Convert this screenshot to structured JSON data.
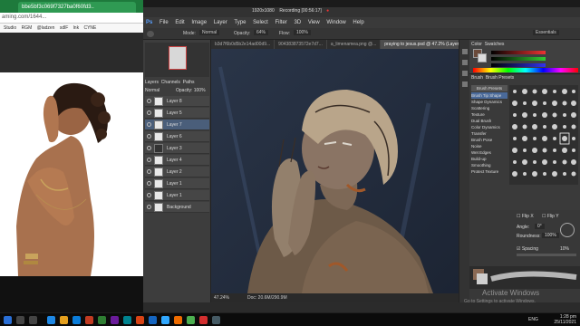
{
  "browser": {
    "tab_title": "bbe5bf3c069f7327ba0f60fd3..",
    "url": "aming.com/1644...",
    "bookmarks": [
      "Studio",
      "RGM",
      "@ladzen",
      "sdlF",
      "lnk",
      "CYNE"
    ]
  },
  "photoshop": {
    "recording": "Recording [00:56:17]",
    "resolution": "1920x1080",
    "menu": [
      "File",
      "Edit",
      "Image",
      "Layer",
      "Type",
      "Select",
      "Filter",
      "3D",
      "View",
      "Window",
      "Help"
    ],
    "options": {
      "mode_label": "Mode:",
      "mode": "Normal",
      "opacity_label": "Opacity:",
      "opacity": "64%",
      "flow_label": "Flow:",
      "flow": "100%"
    },
    "doc_tabs": [
      "b3d7f6b0d5b2e14ad00d9...",
      "904383873572e7d7...",
      "a_limenamea.png @...",
      "praying to jesus.psd @ 47.2% (Layer 7, RGB/8#)"
    ],
    "zoom": "47.24%",
    "doc_size": "Doc: 20.6M/290.9M",
    "layers_header": [
      "Layers",
      "Channels",
      "Paths"
    ],
    "layer_mode": "Normal",
    "layer_opacity": "Opacity: 100%",
    "layers": [
      "Layer 8",
      "Layer 5",
      "Layer 7",
      "Layer 6",
      "Layer 3",
      "Layer 4",
      "Layer 2",
      "Layer 1",
      "Layer 1",
      "Background"
    ],
    "active_layer_index": 2,
    "panels": {
      "color_tab": "Color",
      "swatches_tab": "Swatches",
      "brush_tab": "Brush",
      "brush_presets_tab": "Brush Presets",
      "brush_presets_button": "Brush Presets"
    },
    "brush_options": [
      "Brush Tip Shape",
      "Shape Dynamics",
      "Scattering",
      "Texture",
      "Dual Brush",
      "Color Dynamics",
      "Transfer",
      "Brush Pose",
      "Noise",
      "Wet Edges",
      "Build-up",
      "Smoothing",
      "Protect Texture"
    ],
    "brush_settings": {
      "flip_x": "Flip X",
      "flip_y": "Flip Y",
      "angle_label": "Angle:",
      "angle": "0°",
      "roundness_label": "Roundness:",
      "roundness": "100%",
      "spacing_label": "Spacing",
      "spacing": "10%"
    },
    "essentials": "Essentials"
  },
  "watermark": {
    "title": "Activate Windows",
    "subtitle": "Go to Settings to activate Windows."
  },
  "taskbar": {
    "lang": "ENG",
    "time": "1:28 pm",
    "date": "25/11/2021"
  },
  "colors": {
    "browser_green": "#1e7a3c",
    "ps_bg": "#2b2b2b",
    "selection_blue": "#4a5e7a"
  }
}
